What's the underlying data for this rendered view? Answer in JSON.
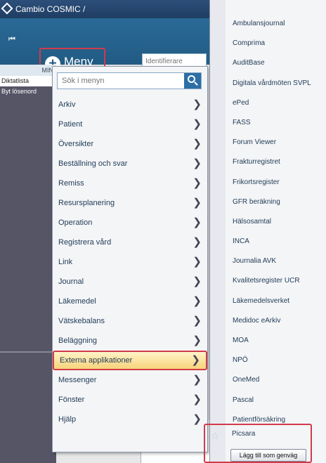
{
  "titlebar": {
    "title": "Cambio COSMIC /"
  },
  "toolbar": {
    "collapse_glyph": "⏮",
    "menu_label": "Meny",
    "identifier_placeholder": "Identifierare"
  },
  "left_panel": {
    "column_header": "MIN",
    "items": [
      "Diktatlista",
      "Byt lösenord"
    ]
  },
  "menu": {
    "search_placeholder": "Sök i menyn",
    "items": [
      {
        "label": "Arkiv"
      },
      {
        "label": "Patient"
      },
      {
        "label": "Översikter"
      },
      {
        "label": "Beställning och svar"
      },
      {
        "label": "Remiss"
      },
      {
        "label": "Resursplanering"
      },
      {
        "label": "Operation"
      },
      {
        "label": "Registrera vård"
      },
      {
        "label": "Link"
      },
      {
        "label": "Journal"
      },
      {
        "label": "Läkemedel"
      },
      {
        "label": "Vätskebalans"
      },
      {
        "label": "Beläggning"
      },
      {
        "label": "Externa applikationer",
        "active": true
      },
      {
        "label": "Messenger"
      },
      {
        "label": "Fönster"
      },
      {
        "label": "Hjälp"
      }
    ]
  },
  "submenu": {
    "items": [
      "Ambulansjournal",
      "Comprima",
      "AuditBase",
      "Digitala vårdmöten SVPL",
      "ePed",
      "FASS",
      "Forum Viewer",
      "Frakturregistret",
      "Frikortsregister",
      "GFR beräkning",
      "Hälsosamtal",
      "INCA",
      "Journalia AVK",
      "Kvalitetsregister UCR",
      "Läkemedelsverket",
      "Medidoc eArkiv",
      "MOA",
      "NPÖ",
      "OneMed",
      "Pascal",
      "Patientförsäkring"
    ],
    "highlighted_item": "Picsara",
    "add_shortcut_label": "Lägg till som genväg",
    "star_icon": "☆"
  },
  "colors": {
    "toolbar_blue": "#215b84",
    "highlight_red": "#d23a4a",
    "active_item_yellow": "#f7d37a"
  }
}
